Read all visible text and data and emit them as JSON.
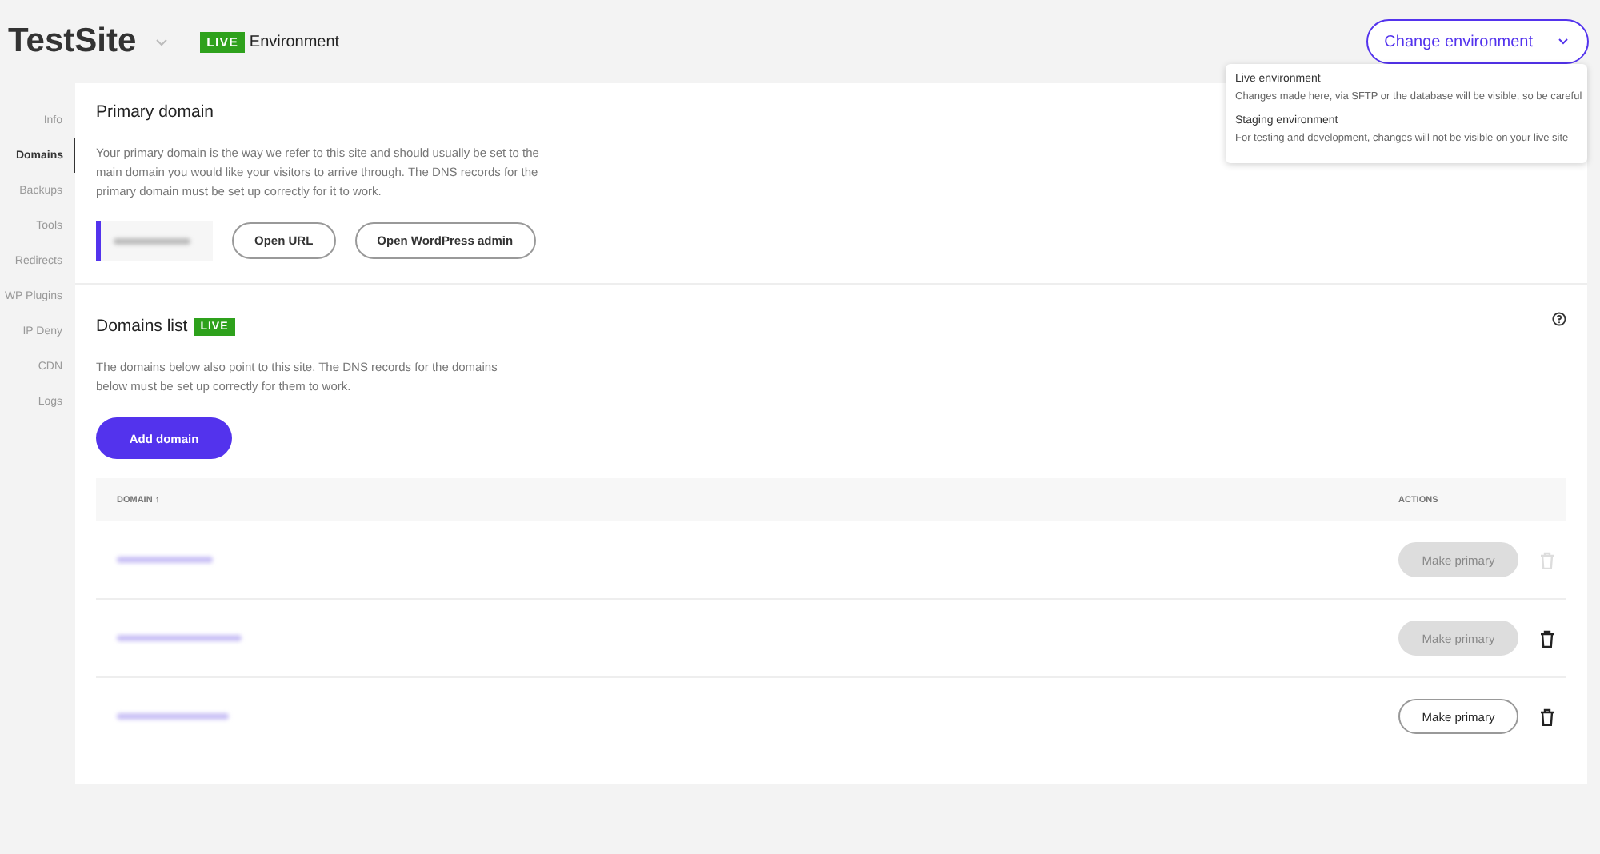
{
  "header": {
    "site_name": "TestSite",
    "env_badge": "LIVE",
    "env_label": "Environment",
    "change_button": "Change environment"
  },
  "env_menu": [
    {
      "title": "Live environment",
      "description": "Changes made here, via SFTP or the database will be visible, so be careful"
    },
    {
      "title": "Staging environment",
      "description": "For testing and development, changes will not be visible on your live site"
    }
  ],
  "sidebar": {
    "items": [
      {
        "label": "Info",
        "selected": false
      },
      {
        "label": "Domains",
        "selected": true
      },
      {
        "label": "Backups",
        "selected": false
      },
      {
        "label": "Tools",
        "selected": false
      },
      {
        "label": "Redirects",
        "selected": false
      },
      {
        "label": "WP Plugins",
        "selected": false
      },
      {
        "label": "IP Deny",
        "selected": false
      },
      {
        "label": "CDN",
        "selected": false
      },
      {
        "label": "Logs",
        "selected": false
      }
    ]
  },
  "primary_domain": {
    "title": "Primary domain",
    "description": "Your primary domain is the way we refer to this site and should usually be set to the main domain you would like your visitors to arrive through. The DNS records for the primary domain must be set up correctly for it to work.",
    "buttons": [
      "Open URL",
      "Open WordPress admin"
    ]
  },
  "domains_list": {
    "title": "Domains list",
    "badge": "LIVE",
    "description": "The domains below also point to this site. The DNS records for the domains below must be set up correctly for them to work.",
    "add_button": "Add domain",
    "table": {
      "columns": [
        "DOMAIN ↑",
        "ACTIONS"
      ],
      "rows": [
        {
          "action": "Make primary",
          "disabled": true,
          "delete_disabled": true
        },
        {
          "action": "Make primary",
          "disabled": true,
          "delete_disabled": false
        },
        {
          "action": "Make primary",
          "disabled": false,
          "delete_disabled": false
        }
      ]
    }
  }
}
